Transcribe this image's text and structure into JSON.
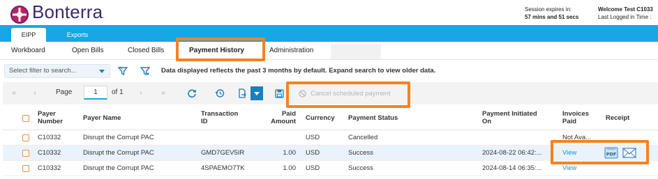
{
  "header": {
    "brand": "Bonterra",
    "brand_suffix": ".",
    "session_line1": "Session expires in:",
    "session_line2": "57 mins and 51 secs",
    "welcome_line1": "Welcome Test C1033",
    "welcome_line2": "Last Logged in Time :"
  },
  "top_tabs": [
    {
      "label": "EIPP",
      "active": true
    },
    {
      "label": "Exports",
      "active": false
    }
  ],
  "sub_tabs": [
    {
      "label": "Workboard"
    },
    {
      "label": "Open Bills"
    },
    {
      "label": "Closed Bills"
    },
    {
      "label": "Payment History",
      "active": true
    },
    {
      "label": "Administration"
    }
  ],
  "filter": {
    "placeholder": "Select filter to search...",
    "message": "Data displayed reflects the past 3 months by default. Expand search to view older data."
  },
  "pager": {
    "first": "«",
    "prev": "‹",
    "label": "Page",
    "current": "1",
    "of": "of 1",
    "next": "›",
    "last": "»"
  },
  "toolbar": {
    "cancel_label": "Cancel scheduled payment"
  },
  "table": {
    "columns": {
      "payer_number": [
        "Payer",
        "Number"
      ],
      "payer_name": "Payer Name",
      "transaction_id": [
        "Transaction",
        "ID"
      ],
      "paid_amount": [
        "Paid",
        "Amount"
      ],
      "currency": "Currency",
      "payment_status": "Payment Status",
      "payment_initiated": [
        "Payment Initiated",
        "On"
      ],
      "invoices_paid": [
        "Invoices",
        "Paid"
      ],
      "receipt": "Receipt"
    },
    "rows": [
      {
        "payer_number": "C10332",
        "payer_name": "Disrupt the Corrupt PAC",
        "transaction_id": "",
        "paid_amount": "",
        "currency": "USD",
        "payment_status": "Cancelled",
        "payment_initiated": "",
        "invoices_paid": "Not Ava...",
        "has_receipt": false
      },
      {
        "payer_number": "C10332",
        "payer_name": "Disrupt the Corrupt PAC",
        "transaction_id": "GMD7GEV5IR",
        "paid_amount": "1.00",
        "currency": "USD",
        "payment_status": "Success",
        "payment_initiated": "2024-08-22 06:42:...",
        "invoices_paid": "View",
        "has_receipt": true
      },
      {
        "payer_number": "C10332",
        "payer_name": "Disrupt the Corrupt PAC",
        "transaction_id": "4SPAEMO7TK",
        "paid_amount": "1.00",
        "currency": "USD",
        "payment_status": "Success",
        "payment_initiated": "2024-08-14 06:35:...",
        "invoices_paid": "View",
        "has_receipt": true
      }
    ]
  },
  "colors": {
    "accent_blue": "#17a7e6",
    "link_blue": "#1a8fd0",
    "highlight_orange": "#f58220",
    "brand_purple": "#3b2a6b"
  },
  "icons": {
    "filter": "filter-icon",
    "filter_clear": "filter-clear-icon",
    "refresh": "refresh-icon",
    "history": "history-icon",
    "export": "export-icon",
    "save": "save-icon",
    "cancel": "ban-icon",
    "pdf": "pdf-icon",
    "email": "envelope-icon"
  }
}
